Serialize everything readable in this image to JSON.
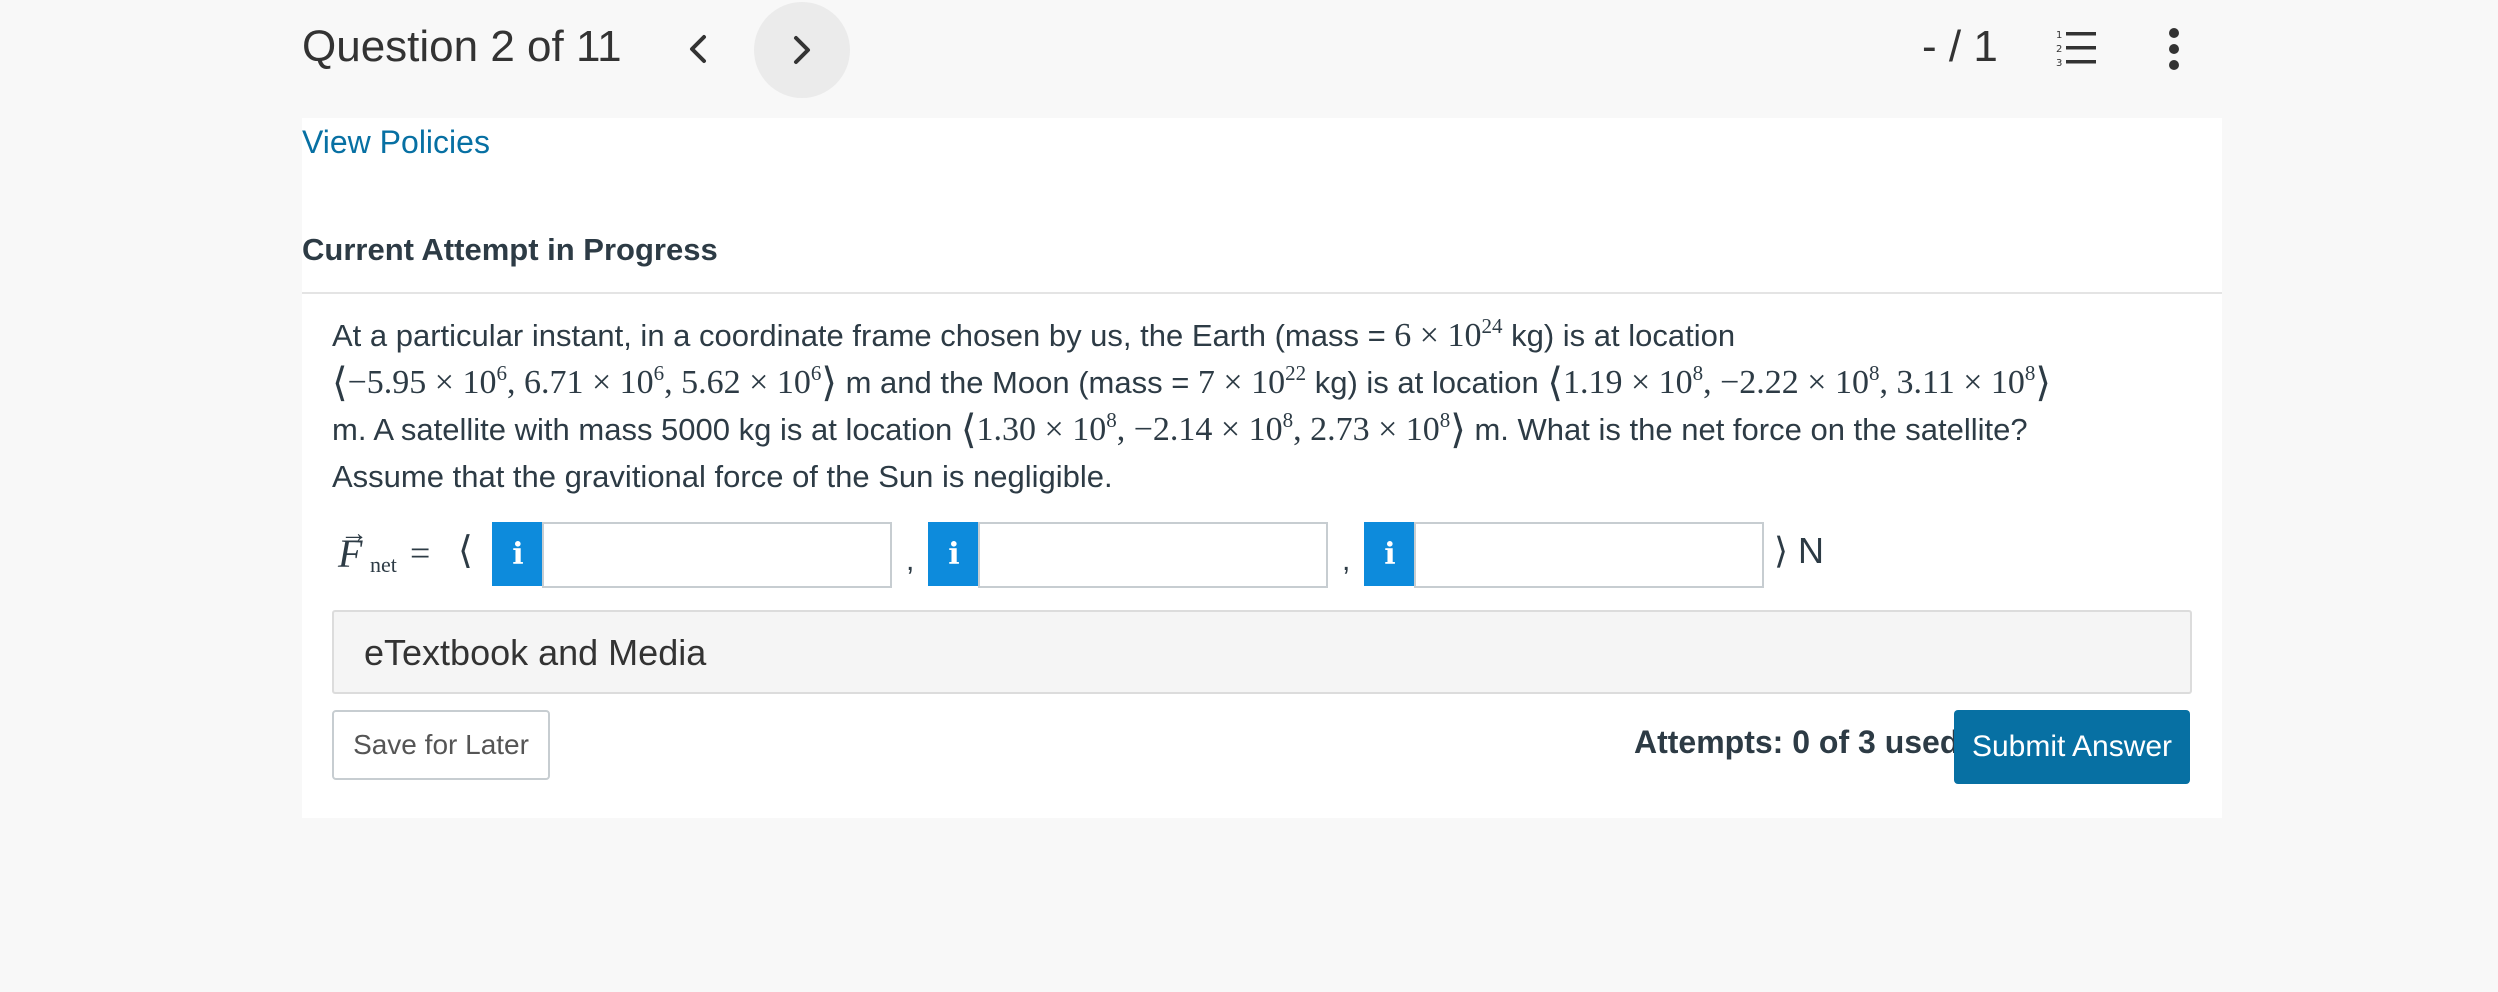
{
  "header": {
    "question_label": "Question 2 of 11",
    "score": "- / 1",
    "prev_icon": "chevron-left-icon",
    "next_icon": "chevron-right-icon",
    "list_icon": "numbered-list-icon",
    "more_icon": "more-vertical-icon"
  },
  "links": {
    "view_policies": "View Policies"
  },
  "attempt": {
    "heading": "Current Attempt in Progress"
  },
  "question": {
    "l1_a": "At a particular instant, in a coordinate frame chosen by us, the Earth (mass = ",
    "earth_mass": "6 × 10",
    "earth_mass_exp": "24",
    "l1_b": " kg) is at location",
    "earth_loc_x": "−5.95 × 10",
    "earth_loc_x_exp": "6",
    "earth_loc_y": "6.71 × 10",
    "earth_loc_y_exp": "6",
    "earth_loc_z": "5.62 × 10",
    "earth_loc_z_exp": "6",
    "l2_a": " m and the Moon (mass = ",
    "moon_mass": "7 × 10",
    "moon_mass_exp": "22",
    "l2_b": " kg) is at location ",
    "moon_loc_x": "1.19 × 10",
    "moon_loc_x_exp": "8",
    "moon_loc_y": "−2.22 × 10",
    "moon_loc_y_exp": "8",
    "moon_loc_z": "3.11 × 10",
    "moon_loc_z_exp": "8",
    "l3_a": " m. A satellite with mass 5000 kg is at location ",
    "sat_loc_x": "1.30 × 10",
    "sat_loc_x_exp": "8",
    "sat_loc_y": "−2.14 × 10",
    "sat_loc_y_exp": "8",
    "sat_loc_z": "2.73 × 10",
    "sat_loc_z_exp": "8",
    "l3_b": " m. What is the net force on the satellite?",
    "l4": "Assume that the gravitional force of the Sun is negligible."
  },
  "answer": {
    "vector_symbol": "F",
    "arrow": "→",
    "subscript": "net",
    "equals": "=",
    "open": "⟨",
    "close_unit": "⟩ N",
    "comma": ",",
    "info_label": "i",
    "field_x": "",
    "field_y": "",
    "field_z": ""
  },
  "media": {
    "label": "eTextbook and Media"
  },
  "footer": {
    "save_label": "Save for Later",
    "attempts_label": "Attempts: 0 of 3 used",
    "submit_label": "Submit Answer"
  },
  "colors": {
    "link": "#0770a3",
    "submit_bg": "#0770a3",
    "info_box": "#0d8bdc",
    "page_bg": "#f8f8f8",
    "panel_bg": "#ffffff"
  }
}
